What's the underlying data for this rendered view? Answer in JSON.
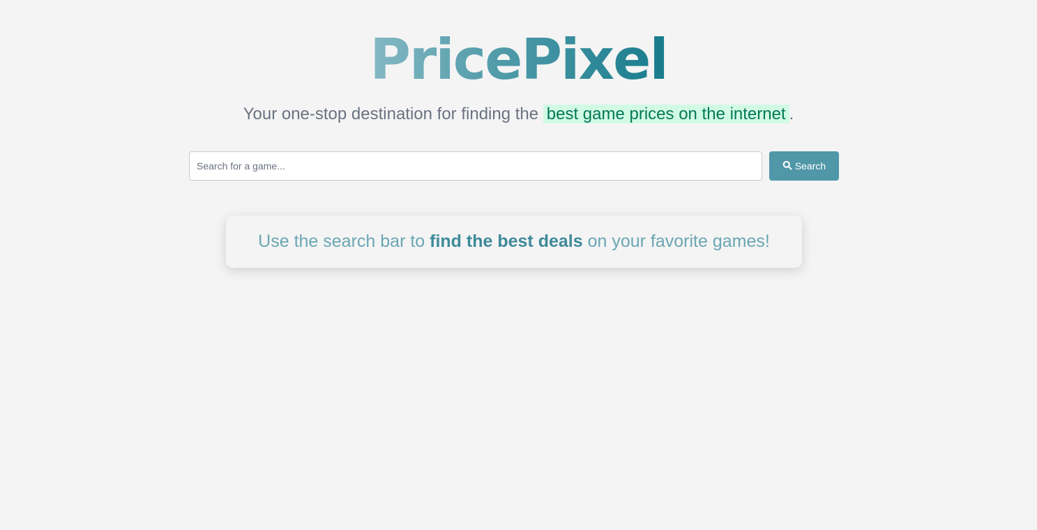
{
  "brand": {
    "name": "PricePixel"
  },
  "tagline": {
    "prefix": "Your one-stop destination for finding the ",
    "highlight": "best game prices on the internet",
    "suffix": "."
  },
  "search": {
    "placeholder": "Search for a game...",
    "value": "",
    "button_label": "Search",
    "button_icon": "search-icon"
  },
  "info": {
    "prefix": "Use the search bar to ",
    "emphasis": "find the best deals",
    "suffix": " on your favorite games!"
  },
  "colors": {
    "background": "#f4f4f4",
    "accent": "#5097a8",
    "highlight_bg": "#d1fae5",
    "highlight_text": "#047857"
  }
}
